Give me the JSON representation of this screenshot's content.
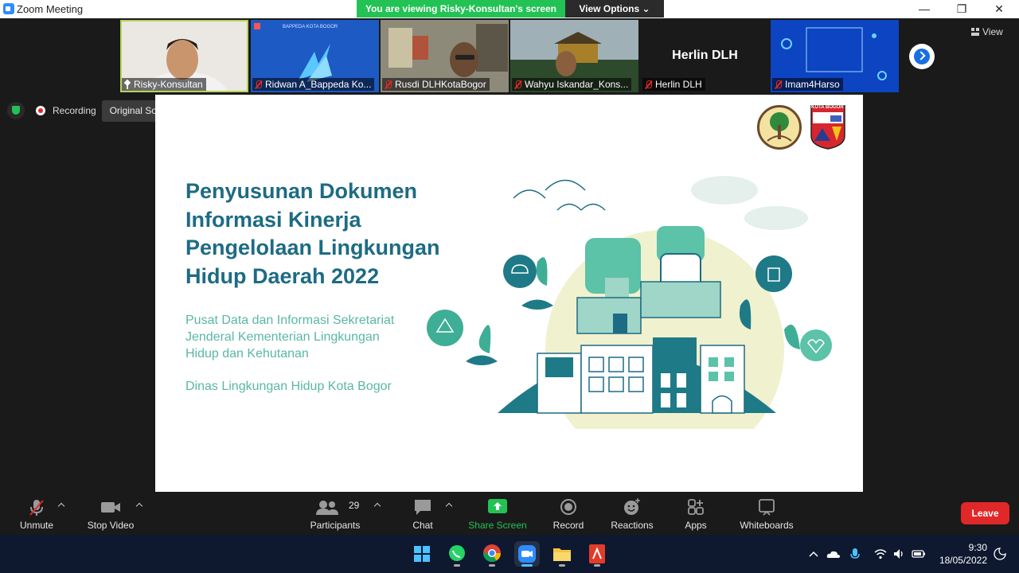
{
  "window": {
    "title": "Zoom Meeting",
    "minimize": "—",
    "maximize": "❐",
    "close": "✕"
  },
  "banner": {
    "viewing": "You are viewing Risky-Konsultan's screen",
    "view_options": "View Options"
  },
  "participants": [
    {
      "name": "Risky-Konsultan",
      "status": "pinned",
      "active": true
    },
    {
      "name": "Ridwan A_Bappeda Ko...",
      "status": "muted"
    },
    {
      "name": "Rusdi DLHKotaBogor",
      "status": "muted"
    },
    {
      "name": "Wahyu Iskandar_Kons...",
      "status": "muted"
    },
    {
      "name": "Herlin DLH",
      "status": "muted",
      "display_name": "Herlin DLH"
    },
    {
      "name": "Imam4Harso",
      "status": "muted"
    }
  ],
  "view_button": "View",
  "recording": {
    "label": "Recording",
    "original_sound": "Original Sound: Off"
  },
  "slide": {
    "title_lines": [
      "Penyusunan Dokumen",
      "Informasi Kinerja",
      "Pengelolaan Lingkungan",
      "Hidup Daerah 2022"
    ],
    "subtitle_lines": [
      "Pusat Data dan Informasi Sekretariat",
      "Jenderal Kementerian Lingkungan",
      "Hidup dan Kehutanan"
    ],
    "org": "Dinas Lingkungan Hidup Kota Bogor",
    "logo_text": "KOTA BOGOR",
    "tile_ridwan_text": "BAPPEDA KOTA BOGOR"
  },
  "toolbar": {
    "unmute": "Unmute",
    "stop_video": "Stop Video",
    "participants": "Participants",
    "participants_count": "29",
    "chat": "Chat",
    "share_screen": "Share Screen",
    "record": "Record",
    "reactions": "Reactions",
    "apps": "Apps",
    "whiteboards": "Whiteboards",
    "leave": "Leave"
  },
  "taskbar": {
    "time": "9:30",
    "date": "18/05/2022"
  },
  "colors": {
    "share_green": "#23c254",
    "leave_red": "#e02828",
    "slide_title": "#1d6b84",
    "slide_teal": "#58b8a3"
  }
}
